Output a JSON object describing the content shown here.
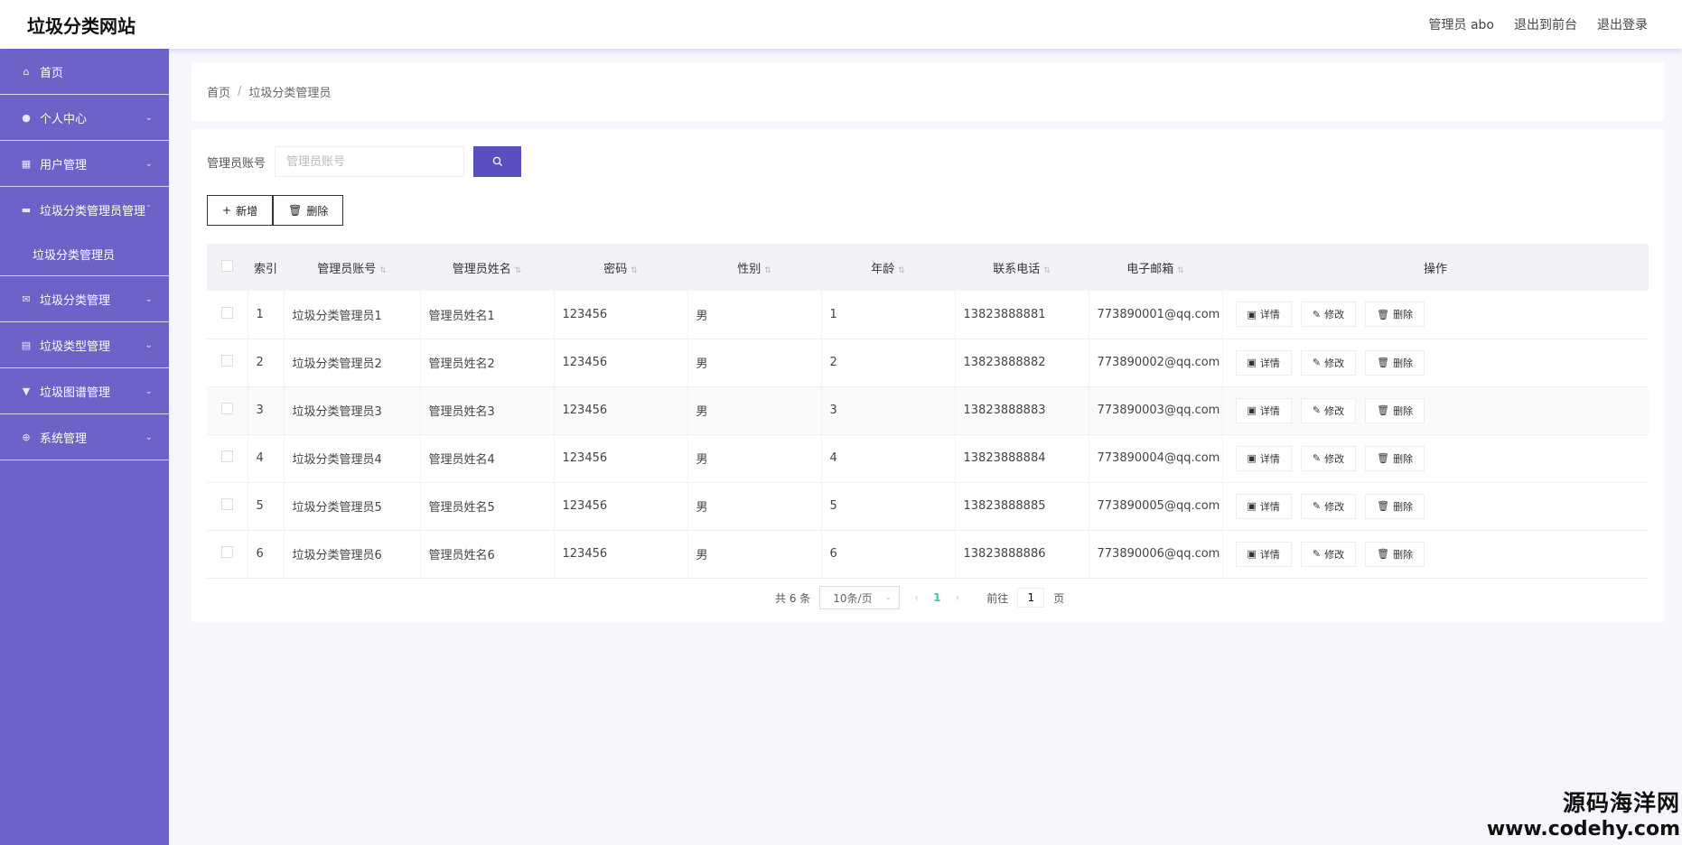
{
  "header": {
    "site_title": "垃圾分类网站",
    "user_label": "管理员 abo",
    "to_front": "退出到前台",
    "logout": "退出登录"
  },
  "sidebar": {
    "items": [
      {
        "label": "首页",
        "icon": "home-icon"
      },
      {
        "label": "个人中心",
        "icon": "user-icon"
      },
      {
        "label": "用户管理",
        "icon": "grid-icon"
      },
      {
        "label": "垃圾分类管理员管理",
        "icon": "bag-icon"
      },
      {
        "label": "垃圾分类管理",
        "icon": "mail-icon"
      },
      {
        "label": "垃圾类型管理",
        "icon": "clipboard-icon"
      },
      {
        "label": "垃圾图谱管理",
        "icon": "filter-icon"
      },
      {
        "label": "系统管理",
        "icon": "globe-icon"
      }
    ],
    "sub_item": "垃圾分类管理员"
  },
  "breadcrumb": {
    "home": "首页",
    "sep": "/",
    "current": "垃圾分类管理员"
  },
  "search": {
    "label": "管理员账号",
    "placeholder": "管理员账号"
  },
  "actions": {
    "add": "新增",
    "delete": "删除"
  },
  "table": {
    "headers": [
      "索引",
      "管理员账号",
      "管理员姓名",
      "密码",
      "性别",
      "年龄",
      "联系电话",
      "电子邮箱",
      "操作"
    ],
    "rows": [
      {
        "index": "1",
        "account": "垃圾分类管理员1",
        "name": "管理员姓名1",
        "password": "123456",
        "gender": "男",
        "age": "1",
        "phone": "13823888881",
        "email": "773890001@qq.com"
      },
      {
        "index": "2",
        "account": "垃圾分类管理员2",
        "name": "管理员姓名2",
        "password": "123456",
        "gender": "男",
        "age": "2",
        "phone": "13823888882",
        "email": "773890002@qq.com"
      },
      {
        "index": "3",
        "account": "垃圾分类管理员3",
        "name": "管理员姓名3",
        "password": "123456",
        "gender": "男",
        "age": "3",
        "phone": "13823888883",
        "email": "773890003@qq.com"
      },
      {
        "index": "4",
        "account": "垃圾分类管理员4",
        "name": "管理员姓名4",
        "password": "123456",
        "gender": "男",
        "age": "4",
        "phone": "13823888884",
        "email": "773890004@qq.com"
      },
      {
        "index": "5",
        "account": "垃圾分类管理员5",
        "name": "管理员姓名5",
        "password": "123456",
        "gender": "男",
        "age": "5",
        "phone": "13823888885",
        "email": "773890005@qq.com"
      },
      {
        "index": "6",
        "account": "垃圾分类管理员6",
        "name": "管理员姓名6",
        "password": "123456",
        "gender": "男",
        "age": "6",
        "phone": "13823888886",
        "email": "773890006@qq.com"
      }
    ],
    "ops": {
      "detail": "详情",
      "edit": "修改",
      "delete": "删除"
    }
  },
  "pager": {
    "total": "共 6 条",
    "page_size": "10条/页",
    "current_page": "1",
    "goto_label": "前往",
    "goto_value": "1",
    "page_unit": "页"
  },
  "watermark": {
    "cn": "源码海洋网",
    "url": "www.codehy.com"
  },
  "colors": {
    "sidebar": "#6c62c8",
    "accent": "#5a4fc0",
    "current_page": "#33cc99"
  }
}
